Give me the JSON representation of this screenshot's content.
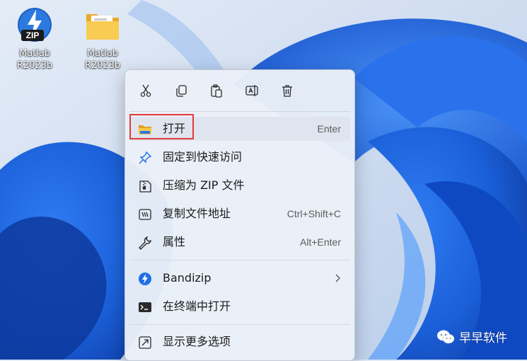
{
  "desktop": {
    "icons": [
      {
        "label": "Matlab\nR2023b",
        "icon": "zip-archive-icon",
        "badge": "ZIP"
      },
      {
        "label": "Matlab\nR2023b",
        "icon": "folder-icon"
      }
    ]
  },
  "context_menu": {
    "toolbar": [
      {
        "icon": "cut-icon"
      },
      {
        "icon": "copy-icon"
      },
      {
        "icon": "paste-icon"
      },
      {
        "icon": "rename-icon"
      },
      {
        "icon": "delete-icon"
      }
    ],
    "items": [
      {
        "icon": "open-folder-icon",
        "label": "打开",
        "shortcut": "Enter"
      },
      {
        "icon": "pin-icon",
        "label": "固定到快速访问",
        "shortcut": ""
      },
      {
        "icon": "compress-zip-icon",
        "label": "压缩为 ZIP 文件",
        "shortcut": ""
      },
      {
        "icon": "copy-path-icon",
        "label": "复制文件地址",
        "shortcut": "Ctrl+Shift+C"
      },
      {
        "icon": "properties-wrench-icon",
        "label": "属性",
        "shortcut": "Alt+Enter"
      },
      {
        "icon": "bandizip-icon",
        "label": "Bandizip",
        "shortcut": ""
      },
      {
        "icon": "terminal-icon",
        "label": "在终端中打开",
        "shortcut": ""
      },
      {
        "icon": "more-options-icon",
        "label": "显示更多选项",
        "shortcut": ""
      }
    ]
  },
  "watermark": {
    "text": "早早软件",
    "icon": "wechat-icon"
  },
  "colors": {
    "accent": "#1f6fe5",
    "highlight": "#e23a3a",
    "folder": "#f5c242"
  }
}
